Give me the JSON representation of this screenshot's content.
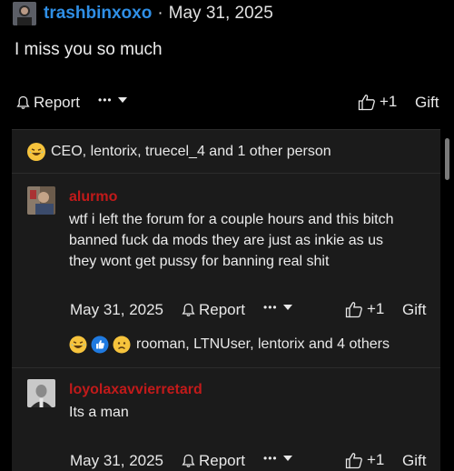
{
  "post": {
    "username": "trashbinxoxo",
    "separator": "·",
    "date": "May 31, 2025",
    "text": "I miss you so much",
    "actions": {
      "report": "Report",
      "dots": "•••",
      "like": "+1",
      "gift": "Gift"
    },
    "reactors": "CEO, lentorix, truecel_4 and 1 other person"
  },
  "replies": [
    {
      "username": "alurmo",
      "text_lines": [
        "wtf i left the forum for a couple hours and this bitch",
        "banned fuck da mods they are just as inkie as us",
        "they wont get pussy for banning real shit"
      ],
      "date": "May 31, 2025",
      "report": "Report",
      "dots": "•••",
      "like": "+1",
      "gift": "Gift",
      "reactors": "rooman, LTNUser, lentorix and 4 others"
    },
    {
      "username": "loyolaxavvierretard",
      "text_lines": [
        "Its a man"
      ],
      "date": "May 31, 2025",
      "report": "Report",
      "dots": "•••",
      "like": "+1",
      "gift": "Gift"
    }
  ],
  "icons": {
    "bell": "bell-icon",
    "thumbs_up": "thumbs-up-icon",
    "laugh": "laughing-emoji-icon",
    "like_reaction": "thumbs-up-reaction-icon",
    "sad": "sad-emoji-icon"
  },
  "colors": {
    "username_top": "#2f8fe6",
    "reply_username": "#c11a1a",
    "background": "#000000",
    "panel": "#1b1b1b"
  }
}
